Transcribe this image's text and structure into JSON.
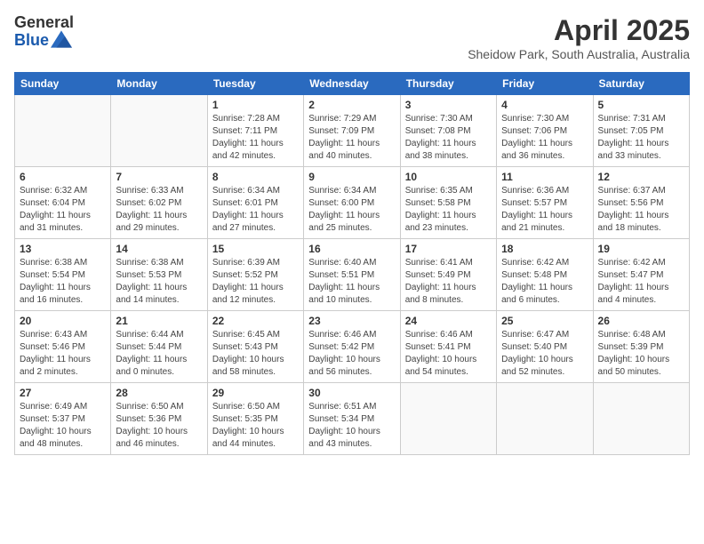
{
  "header": {
    "logo_general": "General",
    "logo_blue": "Blue",
    "month": "April 2025",
    "location": "Sheidow Park, South Australia, Australia"
  },
  "weekdays": [
    "Sunday",
    "Monday",
    "Tuesday",
    "Wednesday",
    "Thursday",
    "Friday",
    "Saturday"
  ],
  "weeks": [
    [
      {
        "day": "",
        "empty": true
      },
      {
        "day": "",
        "empty": true
      },
      {
        "day": "1",
        "sunrise": "Sunrise: 7:28 AM",
        "sunset": "Sunset: 7:11 PM",
        "daylight": "Daylight: 11 hours and 42 minutes."
      },
      {
        "day": "2",
        "sunrise": "Sunrise: 7:29 AM",
        "sunset": "Sunset: 7:09 PM",
        "daylight": "Daylight: 11 hours and 40 minutes."
      },
      {
        "day": "3",
        "sunrise": "Sunrise: 7:30 AM",
        "sunset": "Sunset: 7:08 PM",
        "daylight": "Daylight: 11 hours and 38 minutes."
      },
      {
        "day": "4",
        "sunrise": "Sunrise: 7:30 AM",
        "sunset": "Sunset: 7:06 PM",
        "daylight": "Daylight: 11 hours and 36 minutes."
      },
      {
        "day": "5",
        "sunrise": "Sunrise: 7:31 AM",
        "sunset": "Sunset: 7:05 PM",
        "daylight": "Daylight: 11 hours and 33 minutes."
      }
    ],
    [
      {
        "day": "6",
        "sunrise": "Sunrise: 6:32 AM",
        "sunset": "Sunset: 6:04 PM",
        "daylight": "Daylight: 11 hours and 31 minutes."
      },
      {
        "day": "7",
        "sunrise": "Sunrise: 6:33 AM",
        "sunset": "Sunset: 6:02 PM",
        "daylight": "Daylight: 11 hours and 29 minutes."
      },
      {
        "day": "8",
        "sunrise": "Sunrise: 6:34 AM",
        "sunset": "Sunset: 6:01 PM",
        "daylight": "Daylight: 11 hours and 27 minutes."
      },
      {
        "day": "9",
        "sunrise": "Sunrise: 6:34 AM",
        "sunset": "Sunset: 6:00 PM",
        "daylight": "Daylight: 11 hours and 25 minutes."
      },
      {
        "day": "10",
        "sunrise": "Sunrise: 6:35 AM",
        "sunset": "Sunset: 5:58 PM",
        "daylight": "Daylight: 11 hours and 23 minutes."
      },
      {
        "day": "11",
        "sunrise": "Sunrise: 6:36 AM",
        "sunset": "Sunset: 5:57 PM",
        "daylight": "Daylight: 11 hours and 21 minutes."
      },
      {
        "day": "12",
        "sunrise": "Sunrise: 6:37 AM",
        "sunset": "Sunset: 5:56 PM",
        "daylight": "Daylight: 11 hours and 18 minutes."
      }
    ],
    [
      {
        "day": "13",
        "sunrise": "Sunrise: 6:38 AM",
        "sunset": "Sunset: 5:54 PM",
        "daylight": "Daylight: 11 hours and 16 minutes."
      },
      {
        "day": "14",
        "sunrise": "Sunrise: 6:38 AM",
        "sunset": "Sunset: 5:53 PM",
        "daylight": "Daylight: 11 hours and 14 minutes."
      },
      {
        "day": "15",
        "sunrise": "Sunrise: 6:39 AM",
        "sunset": "Sunset: 5:52 PM",
        "daylight": "Daylight: 11 hours and 12 minutes."
      },
      {
        "day": "16",
        "sunrise": "Sunrise: 6:40 AM",
        "sunset": "Sunset: 5:51 PM",
        "daylight": "Daylight: 11 hours and 10 minutes."
      },
      {
        "day": "17",
        "sunrise": "Sunrise: 6:41 AM",
        "sunset": "Sunset: 5:49 PM",
        "daylight": "Daylight: 11 hours and 8 minutes."
      },
      {
        "day": "18",
        "sunrise": "Sunrise: 6:42 AM",
        "sunset": "Sunset: 5:48 PM",
        "daylight": "Daylight: 11 hours and 6 minutes."
      },
      {
        "day": "19",
        "sunrise": "Sunrise: 6:42 AM",
        "sunset": "Sunset: 5:47 PM",
        "daylight": "Daylight: 11 hours and 4 minutes."
      }
    ],
    [
      {
        "day": "20",
        "sunrise": "Sunrise: 6:43 AM",
        "sunset": "Sunset: 5:46 PM",
        "daylight": "Daylight: 11 hours and 2 minutes."
      },
      {
        "day": "21",
        "sunrise": "Sunrise: 6:44 AM",
        "sunset": "Sunset: 5:44 PM",
        "daylight": "Daylight: 11 hours and 0 minutes."
      },
      {
        "day": "22",
        "sunrise": "Sunrise: 6:45 AM",
        "sunset": "Sunset: 5:43 PM",
        "daylight": "Daylight: 10 hours and 58 minutes."
      },
      {
        "day": "23",
        "sunrise": "Sunrise: 6:46 AM",
        "sunset": "Sunset: 5:42 PM",
        "daylight": "Daylight: 10 hours and 56 minutes."
      },
      {
        "day": "24",
        "sunrise": "Sunrise: 6:46 AM",
        "sunset": "Sunset: 5:41 PM",
        "daylight": "Daylight: 10 hours and 54 minutes."
      },
      {
        "day": "25",
        "sunrise": "Sunrise: 6:47 AM",
        "sunset": "Sunset: 5:40 PM",
        "daylight": "Daylight: 10 hours and 52 minutes."
      },
      {
        "day": "26",
        "sunrise": "Sunrise: 6:48 AM",
        "sunset": "Sunset: 5:39 PM",
        "daylight": "Daylight: 10 hours and 50 minutes."
      }
    ],
    [
      {
        "day": "27",
        "sunrise": "Sunrise: 6:49 AM",
        "sunset": "Sunset: 5:37 PM",
        "daylight": "Daylight: 10 hours and 48 minutes."
      },
      {
        "day": "28",
        "sunrise": "Sunrise: 6:50 AM",
        "sunset": "Sunset: 5:36 PM",
        "daylight": "Daylight: 10 hours and 46 minutes."
      },
      {
        "day": "29",
        "sunrise": "Sunrise: 6:50 AM",
        "sunset": "Sunset: 5:35 PM",
        "daylight": "Daylight: 10 hours and 44 minutes."
      },
      {
        "day": "30",
        "sunrise": "Sunrise: 6:51 AM",
        "sunset": "Sunset: 5:34 PM",
        "daylight": "Daylight: 10 hours and 43 minutes."
      },
      {
        "day": "",
        "empty": true
      },
      {
        "day": "",
        "empty": true
      },
      {
        "day": "",
        "empty": true
      }
    ]
  ]
}
